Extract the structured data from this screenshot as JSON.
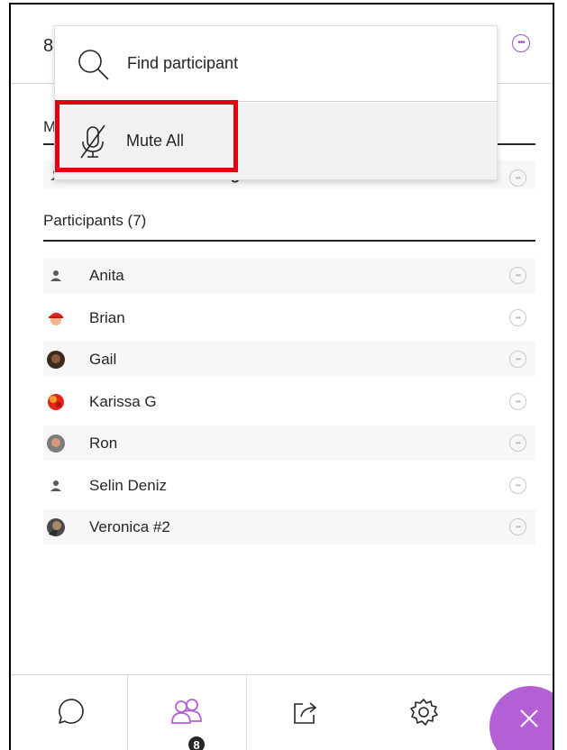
{
  "header": {
    "count": "8"
  },
  "dropdown": {
    "find_label": "Find participant",
    "mute_label": "Mute All"
  },
  "moderators": {
    "heading": "M",
    "items": [
      {
        "name": "Deniz Uzunosmanoglu",
        "avatar": "default-user-icon"
      }
    ]
  },
  "participants": {
    "heading": "Participants (7)",
    "items": [
      {
        "name": "Anita",
        "avatar": "default-user-icon"
      },
      {
        "name": "Brian",
        "avatar": "red-hat-avatar"
      },
      {
        "name": "Gail",
        "avatar": "photo-avatar"
      },
      {
        "name": "Karissa G",
        "avatar": "flower-avatar"
      },
      {
        "name": "Ron",
        "avatar": "photo-avatar"
      },
      {
        "name": "Selin Deniz",
        "avatar": "default-user-icon"
      },
      {
        "name": "Veronica #2",
        "avatar": "photo-avatar"
      }
    ]
  },
  "toolbar": {
    "people_badge": "8"
  },
  "colors": {
    "accent": "#b35fd6",
    "highlight": "#e3000f",
    "text": "#262626"
  }
}
